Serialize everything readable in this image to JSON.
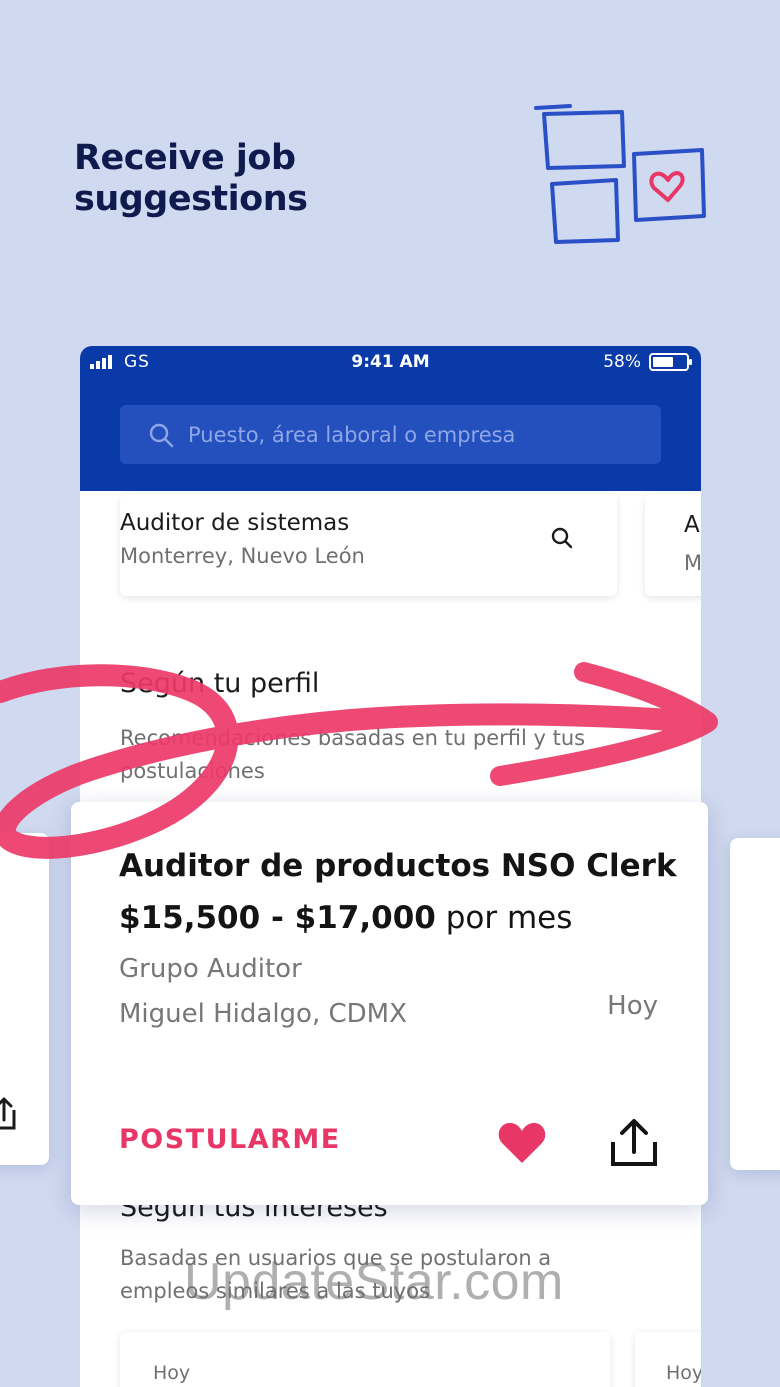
{
  "headline": {
    "line1": "Receive job",
    "line2": "suggestions"
  },
  "status_bar": {
    "carrier": "GS",
    "time": "9:41 AM",
    "battery": "58%"
  },
  "search": {
    "placeholder": "Puesto, área laboral o empresa"
  },
  "recent_search": {
    "title": "Auditor de sistemas",
    "location": "Monterrey, Nuevo León",
    "peek_title_initial": "A",
    "peek_location_initial": "M"
  },
  "section_profile": {
    "title": "Según tu perfil",
    "description": "Recomendaciones basadas en tu perfil y tus postulaciones"
  },
  "job_card": {
    "title": "Auditor de productos NSO Clerk",
    "salary_range": "$15,500 - $17,000",
    "salary_period": "por mes",
    "company": "Grupo Auditor",
    "location": "Miguel Hidalgo, CDMX",
    "posted": "Hoy",
    "apply_label": "POSTULARME",
    "icons": {
      "favorite": "heart-icon",
      "share": "share-icon"
    }
  },
  "section_interests": {
    "title": "Según tus intereses",
    "description": "Basadas en usuarios que se postularon a empleos similares a las tuyos"
  },
  "mini_cards": [
    {
      "posted": "Hoy"
    },
    {
      "posted": "Hoy"
    }
  ],
  "watermark": "UpdateStar.com",
  "colors": {
    "background": "#cfd9ef",
    "header": "#0a3aa8",
    "accent": "#e83667",
    "headline": "#0f1a4e"
  }
}
